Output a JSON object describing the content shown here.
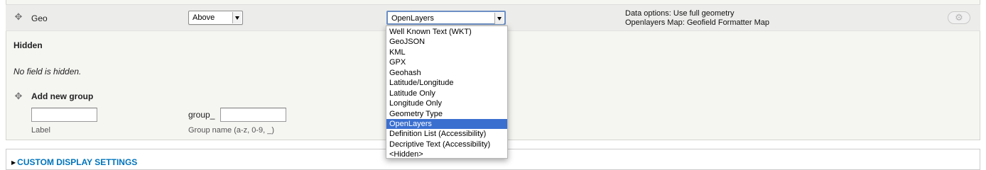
{
  "field_row": {
    "name": "Geo",
    "label_position": "Above",
    "formatter": "OpenLayers",
    "summary": [
      "Data options: Use full geometry",
      "Openlayers Map: Geofield Formatter Map"
    ]
  },
  "hidden_section": {
    "heading": "Hidden",
    "empty_text": "No field is hidden."
  },
  "add_group": {
    "title": "Add new group",
    "label_value": "",
    "label_desc": "Label",
    "group_prefix": "group_",
    "group_value": "",
    "group_desc": "Group name (a-z, 0-9, _)"
  },
  "dropdown": {
    "options": [
      "Well Known Text (WKT)",
      "GeoJSON",
      "KML",
      "GPX",
      "Geohash",
      "Latitude/Longitude",
      "Latitude Only",
      "Longitude Only",
      "Geometry Type",
      "OpenLayers",
      "Definition List (Accessibility)",
      "Decriptive Text (Accessibility)",
      "<Hidden>"
    ],
    "selected": "OpenLayers"
  },
  "custom_display": {
    "legend": "CUSTOM DISPLAY SETTINGS"
  },
  "icons": {
    "drag": "drag-handle-icon",
    "gear": "gear-icon",
    "arrow": "select-arrow-icon"
  }
}
